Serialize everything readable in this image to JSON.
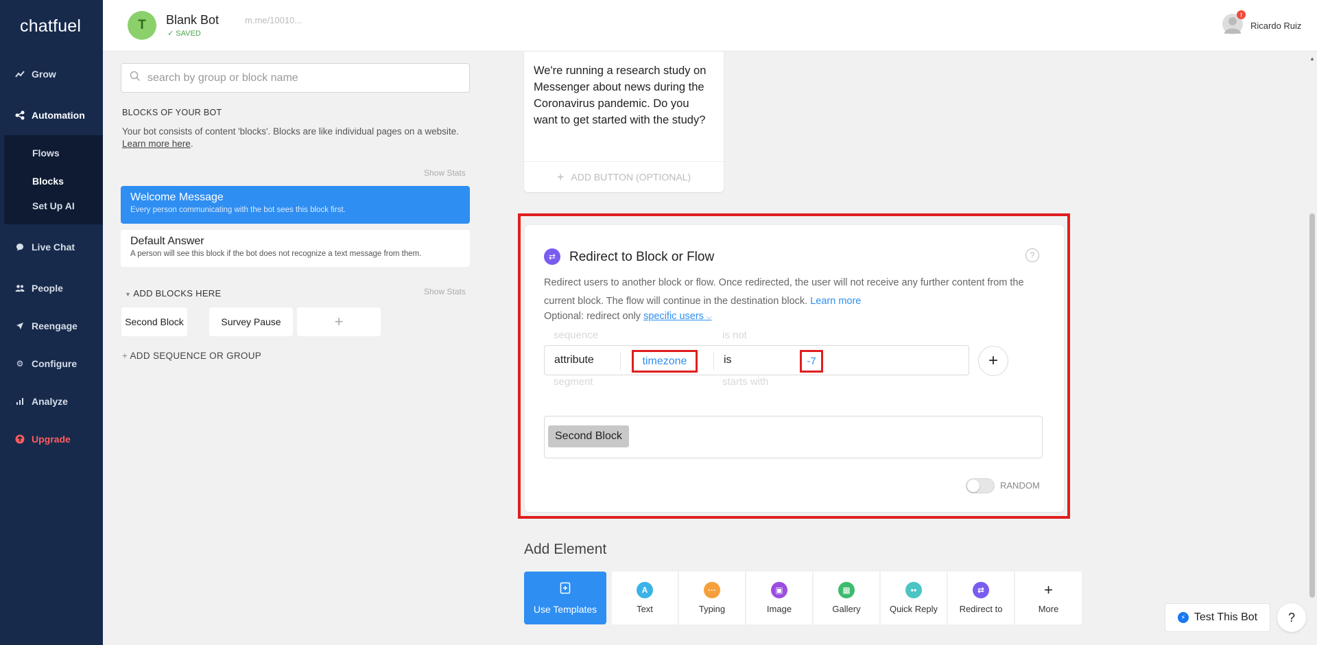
{
  "app": {
    "logo": "chatfuel"
  },
  "sidebar": {
    "items": [
      {
        "label": "Grow",
        "icon": "trending-up-icon"
      },
      {
        "label": "Automation",
        "icon": "flow-icon"
      },
      {
        "label": "Live Chat",
        "icon": "chat-bubble-icon"
      },
      {
        "label": "People",
        "icon": "people-icon"
      },
      {
        "label": "Reengage",
        "icon": "send-icon"
      },
      {
        "label": "Configure",
        "icon": "gear-icon"
      },
      {
        "label": "Analyze",
        "icon": "bar-chart-icon"
      },
      {
        "label": "Upgrade",
        "icon": "upgrade-icon"
      }
    ],
    "sub_items": [
      "Flows",
      "Blocks",
      "Set Up AI"
    ]
  },
  "header": {
    "bot_initial": "T",
    "bot_name": "Blank Bot",
    "saved": "SAVED",
    "bot_link": "m.me/10010...",
    "user_name": "Ricardo Ruiz",
    "badge": "!"
  },
  "blocks_panel": {
    "search_placeholder": "search by group or block name",
    "title": "BLOCKS OF YOUR BOT",
    "desc": "Your bot consists of content 'blocks'. Blocks are like individual pages on a website.",
    "learn_more": "Learn more here",
    "show_stats": "Show Stats",
    "welcome": {
      "title": "Welcome Message",
      "desc": "Every person communicating with the bot sees this block first."
    },
    "default": {
      "title": "Default Answer",
      "desc": "A person will see this block if the bot does not recognize a text message from them."
    },
    "add_blocks_title": "ADD BLOCKS HERE",
    "blocks": [
      "Second Block",
      "Survey Pause"
    ],
    "add_plus": "+",
    "add_sequence": "ADD SEQUENCE OR GROUP"
  },
  "text_card": {
    "body": "We're running a research study on Messenger about news during the Coronavirus pandemic. Do you want to get started with the study?",
    "add_button": "ADD BUTTON (OPTIONAL)"
  },
  "redirect": {
    "title": "Redirect to Block or Flow",
    "help": "?",
    "desc": "Redirect users to another block or flow. Once redirected, the user will not receive any further content from the current block. The flow will continue in the destination block.",
    "learn_more": "Learn more",
    "optional": "Optional: redirect only",
    "specific_users": "specific users",
    "ghost_above_1": "sequence",
    "ghost_above_2": "is not",
    "ghost_below_1": "segment",
    "ghost_below_2": "starts with",
    "field_type": "attribute",
    "field_attr": "timezone",
    "field_op": "is",
    "field_value": "-7",
    "add_rule": "+",
    "target_block": "Second Block",
    "random_label": "RANDOM",
    "random_on": false
  },
  "add_element": {
    "title": "Add Element",
    "use_templates": "Use Templates",
    "tiles": [
      {
        "label": "Text",
        "icon": "A",
        "color": "#3bb3e8"
      },
      {
        "label": "Typing",
        "icon": "···",
        "color": "#f5a03a"
      },
      {
        "label": "Image",
        "icon": "▣",
        "color": "#9b4de0"
      },
      {
        "label": "Gallery",
        "icon": "▦",
        "color": "#3dbb6e"
      },
      {
        "label": "Quick Reply",
        "icon": "••",
        "color": "#4cc4c4"
      },
      {
        "label": "Redirect to",
        "icon": "⇄",
        "color": "#7a5cf0"
      },
      {
        "label": "More",
        "icon": "+",
        "color": "#ffffff"
      }
    ]
  },
  "footer": {
    "test_bot": "Test This Bot",
    "help": "?"
  },
  "colors": {
    "sidebar": "#172a4c",
    "accent": "#2e8ef2",
    "highlight": "#e01e1e",
    "upgrade": "#ff5c5c"
  }
}
